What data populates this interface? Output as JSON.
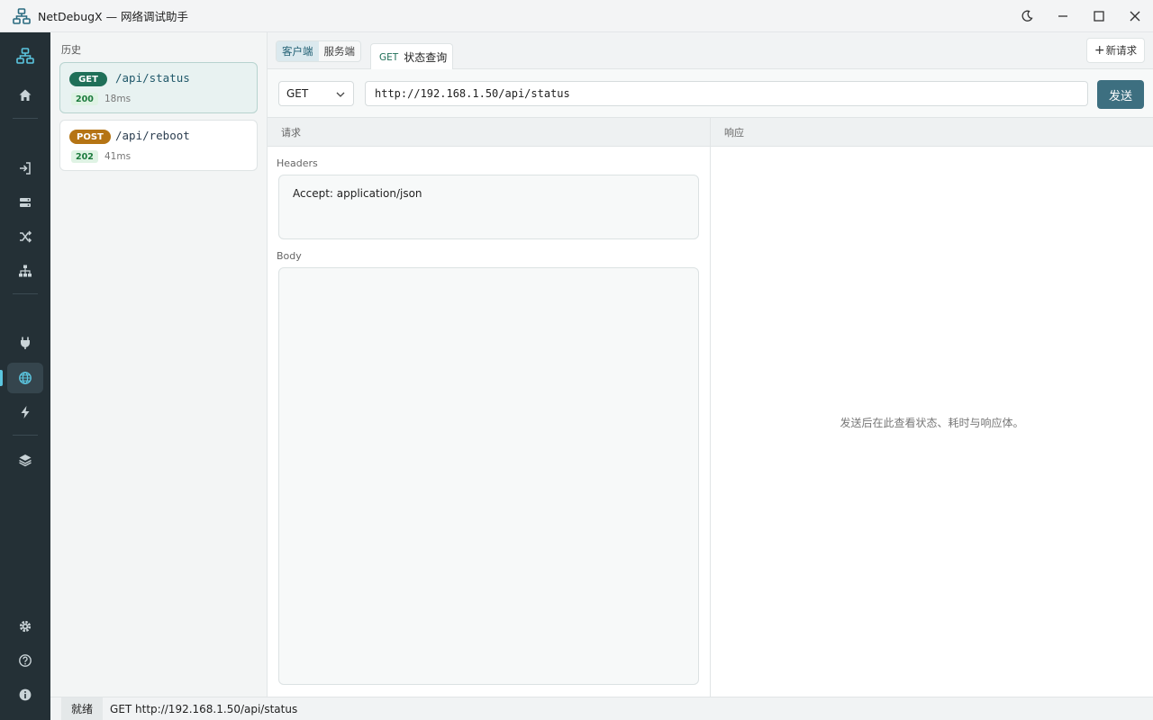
{
  "app": {
    "title": "NetDebugX — 网络调试助手"
  },
  "activity_bar": {
    "items": [
      "network-icon",
      "home-icon",
      "login-icon",
      "server-icon",
      "shuffle-icon",
      "sitemap-icon",
      "plug-icon",
      "globe-icon",
      "bolt-icon",
      "layers-icon",
      "settings-icon",
      "help-icon",
      "info-icon"
    ],
    "active": "globe-icon",
    "accent": "#5bc6e0"
  },
  "history": {
    "title": "历史",
    "items": [
      {
        "method": "GET",
        "path": "/api/status",
        "status": "200",
        "time": "18ms",
        "selected": true
      },
      {
        "method": "POST",
        "path": "/api/reboot",
        "status": "202",
        "time": "41ms",
        "selected": false
      }
    ]
  },
  "tabs": {
    "mode_client": "客户端",
    "mode_server": "服务端",
    "active_mode": "客户端",
    "request_tab": {
      "method": "GET",
      "name": "状态查询"
    },
    "new_request": "新请求"
  },
  "request_bar": {
    "method": "GET",
    "url": "http://192.168.1.50/api/status",
    "send_label": "发送"
  },
  "request_pane": {
    "title": "请求",
    "headers_label": "Headers",
    "headers_value": "Accept: application/json",
    "body_label": "Body",
    "body_value": ""
  },
  "response_pane": {
    "title": "响应",
    "empty_hint": "发送后在此查看状态、耗时与响应体。"
  },
  "statusbar": {
    "ready": "就绪",
    "info": "GET http://192.168.1.50/api/status"
  },
  "colors": {
    "brand": "#3d6f80",
    "get": "#1f6f58",
    "post": "#b57414",
    "sidebar": "#243036"
  }
}
